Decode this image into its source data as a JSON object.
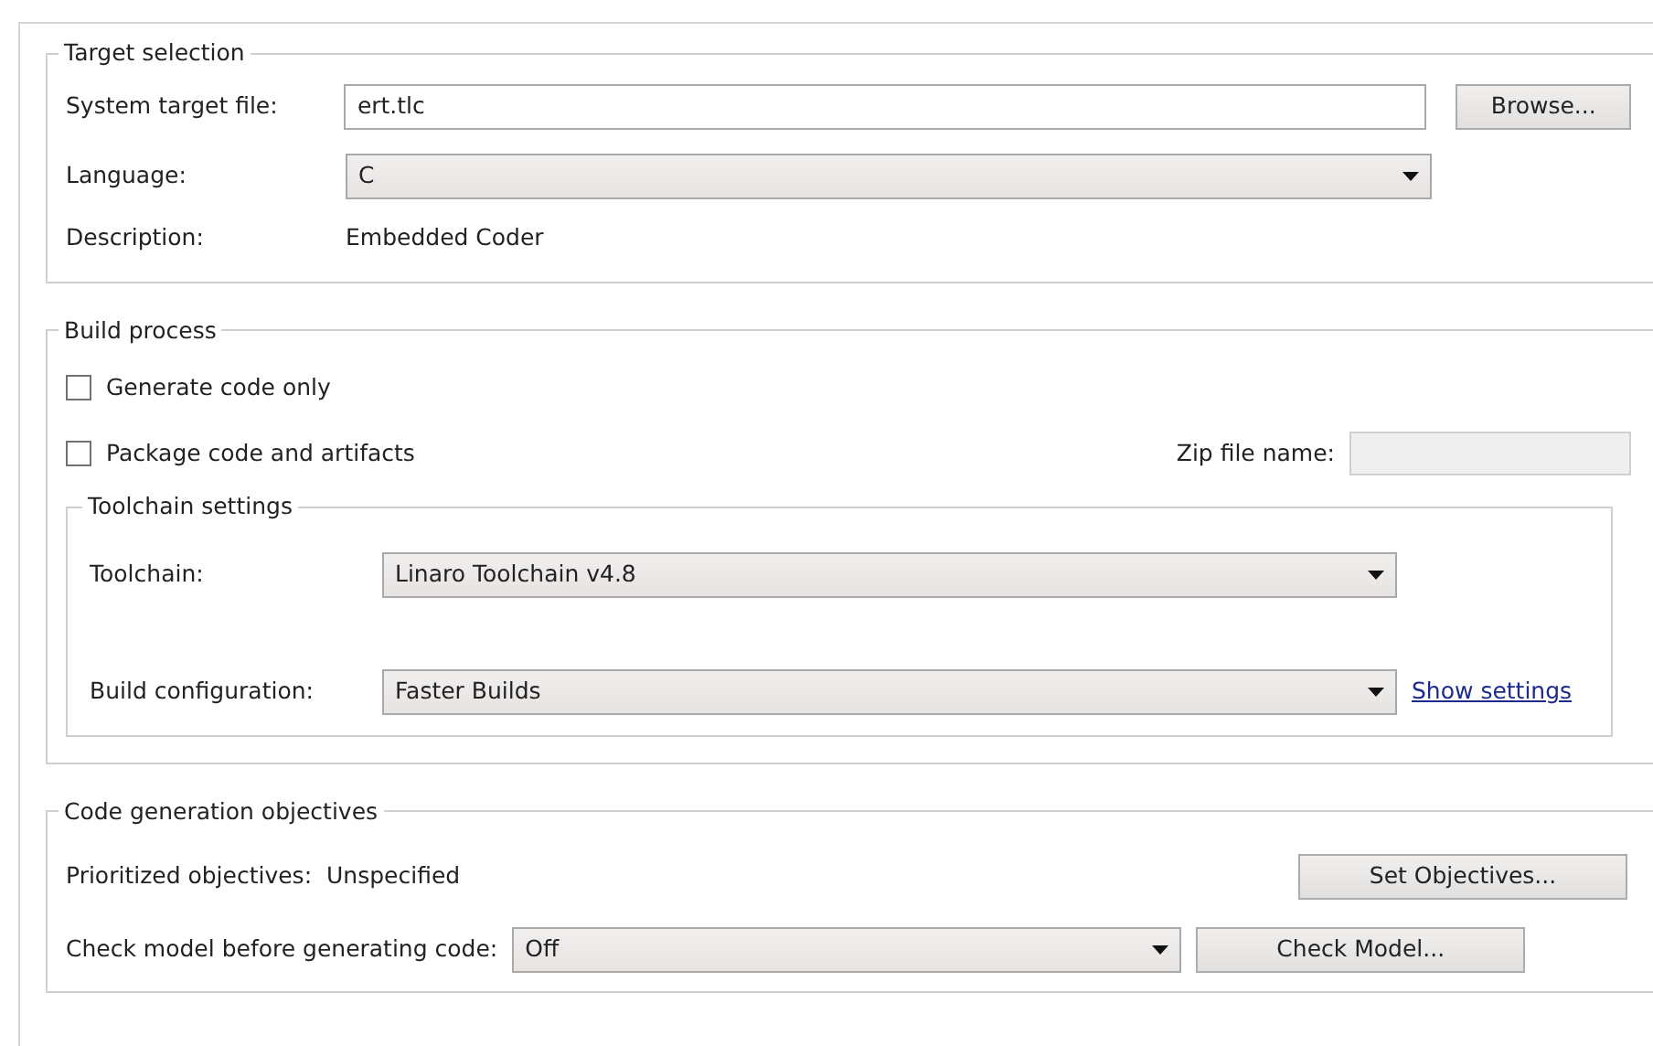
{
  "target_selection": {
    "title": "Target selection",
    "system_target_file": {
      "label": "System target file:",
      "value": "ert.tlc"
    },
    "browse_button": "Browse...",
    "language": {
      "label": "Language:",
      "value": "C"
    },
    "description": {
      "label": "Description:",
      "value": "Embedded Coder"
    }
  },
  "build_process": {
    "title": "Build process",
    "options": [
      {
        "label": "Generate code only",
        "checked": false
      },
      {
        "label": "Package code and artifacts",
        "checked": false
      }
    ],
    "zip_file_name": {
      "label": "Zip file name:",
      "disabled": true
    },
    "toolchain_settings": {
      "title": "Toolchain settings",
      "toolchain": {
        "label": "Toolchain:",
        "value": "Linaro Toolchain v4.8"
      },
      "build_configuration": {
        "label": "Build configuration:",
        "value": "Faster Builds"
      },
      "show_settings_link": "Show settings"
    }
  },
  "code_generation_objectives": {
    "title": "Code generation objectives",
    "prioritized_objectives": {
      "label": "Prioritized objectives:",
      "value": "Unspecified"
    },
    "set_objectives_button": "Set Objectives...",
    "check_model": {
      "label": "Check model before generating code:",
      "value": "Off"
    },
    "check_model_button": "Check Model..."
  }
}
